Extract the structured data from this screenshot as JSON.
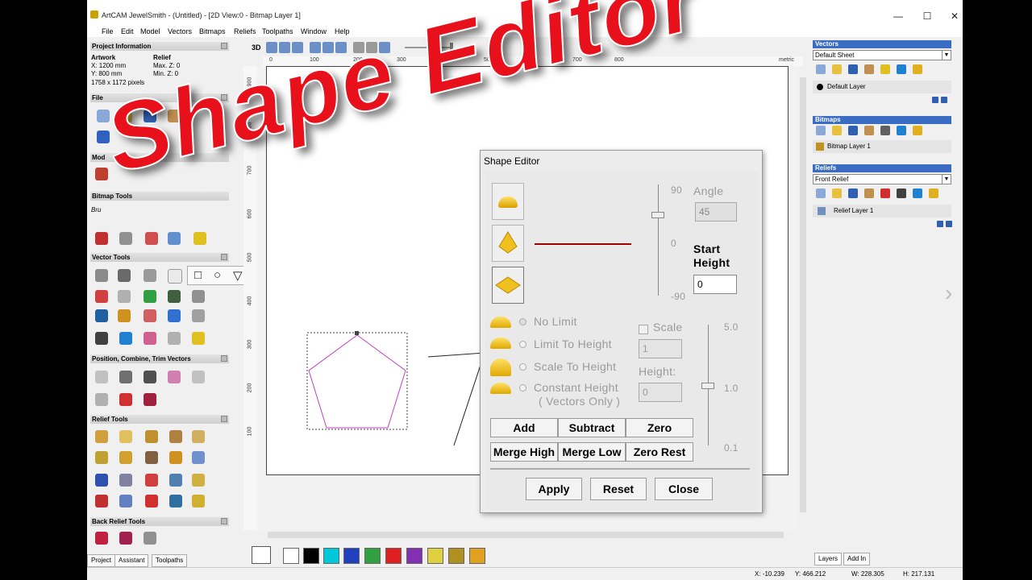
{
  "window": {
    "title": "ArtCAM JewelSmith - (Untitled) - [2D View:0 - Bitmap Layer 1]",
    "min": "—",
    "max": "☐",
    "close": "✕"
  },
  "menu": [
    "File",
    "Edit",
    "Model",
    "Vectors",
    "Bitmaps",
    "Reliefs",
    "Toolpaths",
    "Window",
    "Help"
  ],
  "left": {
    "project_info": "Project Information",
    "artwork": "Artwork",
    "art_x": "X: 1200 mm",
    "art_y": "Y: 800 mm",
    "pixels": "1758 x 1172 pixels",
    "relief": "Relief",
    "maxz": "Max. Z: 0",
    "minz": "Min. Z: 0",
    "file": "File",
    "model": "Mod",
    "bitmap_tools": "Bitmap Tools",
    "brush": "Bru",
    "vector_tools": "Vector Tools",
    "position": "Position, Combine, Trim Vectors",
    "relief_tools": "Relief Tools",
    "back_relief": "Back Relief Tools",
    "tabs": [
      "Project",
      "Assistant",
      "Toolpaths"
    ]
  },
  "right": {
    "vectors": "Vectors",
    "sheet": "Default Sheet",
    "layer": "Default Layer",
    "bitmaps": "Bitmaps",
    "bitmap_layer": "Bitmap Layer 1",
    "reliefs": "Reliefs",
    "relief_combo": "Front Relief",
    "relief_layer": "Relief Layer 1",
    "tabs": [
      "Layers",
      "Add In"
    ]
  },
  "view": {
    "label_3d": "3D",
    "ruler_h": [
      "0",
      "100",
      "200",
      "300",
      "400",
      "500",
      "700",
      "800"
    ],
    "ruler_v": [
      "900",
      "800",
      "700",
      "600",
      "500",
      "400",
      "300",
      "200",
      "100"
    ],
    "units": "mm",
    "metric": "metric"
  },
  "colors": [
    "#ffffff",
    "#000000",
    "#00c8d8",
    "#2040c0",
    "#30a040",
    "#e02020",
    "#8030b0",
    "#e0d040",
    "#b09020",
    "#e0a020"
  ],
  "status": {
    "x": "X: -10.239",
    "y": "Y: 466.212",
    "w": "W: 228.305",
    "h": "H: 217.131"
  },
  "shape_editor": {
    "title": "Shape Editor",
    "angle_label": "Angle",
    "angle_value": "45",
    "scale_top": "90",
    "scale_mid": "0",
    "scale_bot": "-90",
    "start_height": "Start",
    "start_height2": "Height",
    "start_value": "0",
    "no_limit": "No Limit",
    "limit_to_height": "Limit To Height",
    "scale_to_height": "Scale To Height",
    "constant_height": "Constant Height",
    "vectors_only": "( Vectors Only )",
    "scale": "Scale",
    "scale_value": "1",
    "height": "Height:",
    "height_value": "0",
    "slider2_top": "5.0",
    "slider2_mid": "1.0",
    "slider2_bot": "0.1",
    "buttons": {
      "add": "Add",
      "subtract": "Subtract",
      "zero": "Zero",
      "merge_high": "Merge High",
      "merge_low": "Merge Low",
      "zero_rest": "Zero Rest",
      "apply": "Apply",
      "reset": "Reset",
      "close": "Close"
    }
  },
  "overlay": {
    "text": "Shape Editor",
    "color": "#e8101b"
  }
}
